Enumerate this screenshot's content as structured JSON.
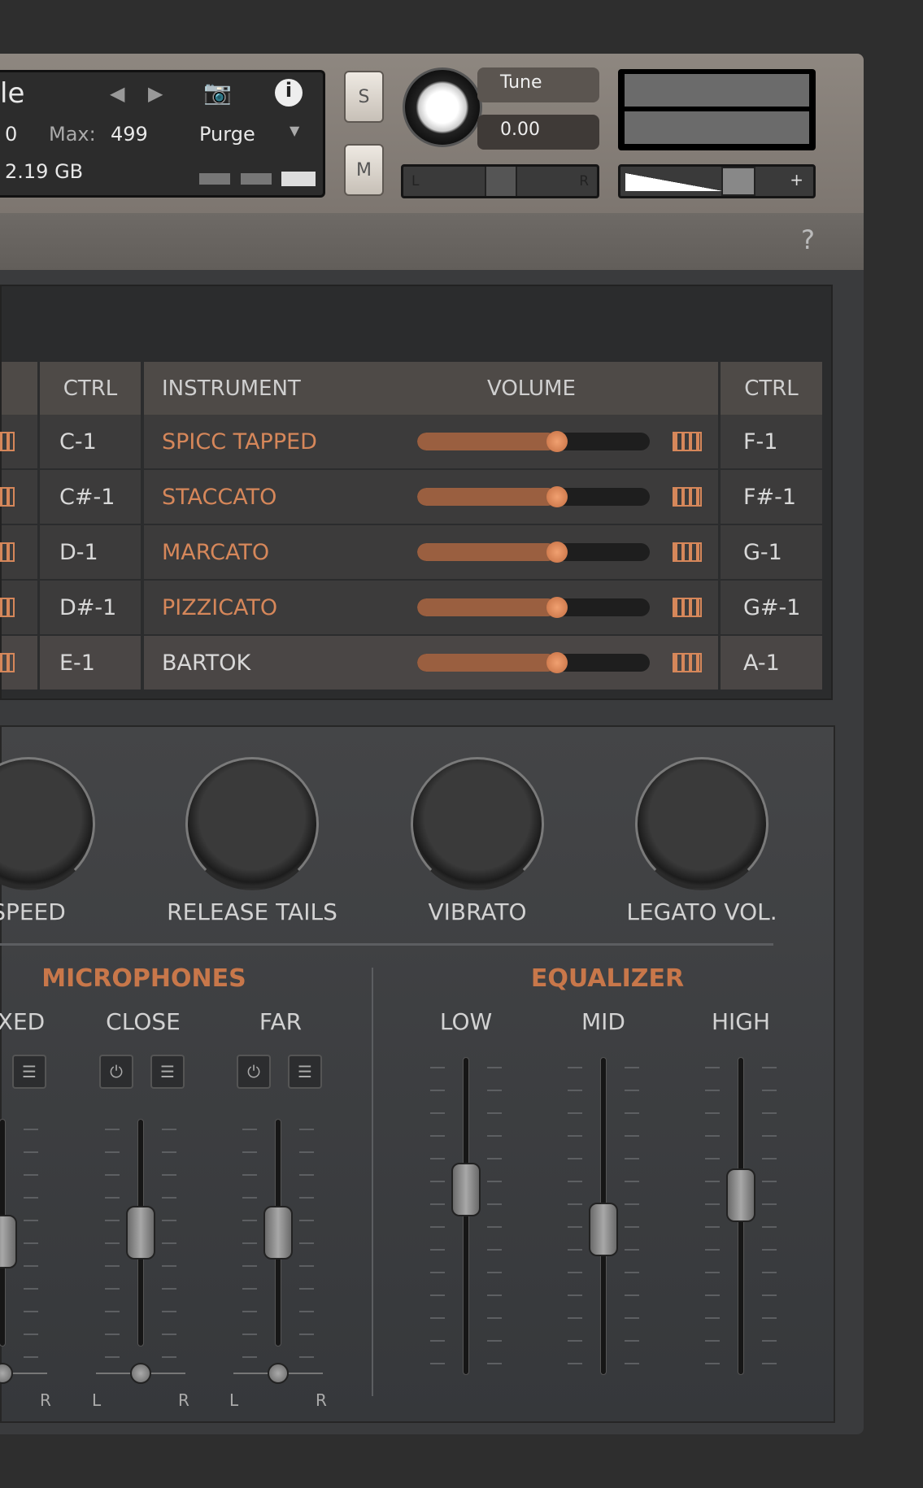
{
  "header": {
    "instrument_name_partial": "le",
    "voices": "0",
    "max_label": "Max:",
    "max_value": "499",
    "memory": "2.19 GB",
    "purge_label": "Purge",
    "solo": "S",
    "mute": "M",
    "tune_label": "Tune",
    "tune_value": "0.00",
    "pan_left": "L",
    "pan_right": "R",
    "vol_minus": "-",
    "vol_plus": "+",
    "help": "?"
  },
  "table": {
    "headers": [
      "CTRL",
      "INSTRUMENT",
      "VOLUME",
      "CTRL"
    ],
    "rows": [
      {
        "ctrl_left": "C-1",
        "instrument": "SPICC TAPPED",
        "volume": 0.6,
        "ctrl_right": "F-1",
        "active": false
      },
      {
        "ctrl_left": "C#-1",
        "instrument": "STACCATO",
        "volume": 0.6,
        "ctrl_right": "F#-1",
        "active": false
      },
      {
        "ctrl_left": "D-1",
        "instrument": "MARCATO",
        "volume": 0.6,
        "ctrl_right": "G-1",
        "active": false
      },
      {
        "ctrl_left": "D#-1",
        "instrument": "PIZZICATO",
        "volume": 0.6,
        "ctrl_right": "G#-1",
        "active": false
      },
      {
        "ctrl_left": "E-1",
        "instrument": "BARTOK",
        "volume": 0.6,
        "ctrl_right": "A-1",
        "active": true
      }
    ]
  },
  "knobs": [
    "SPEED",
    "RELEASE TAILS",
    "VIBRATO",
    "LEGATO VOL."
  ],
  "microphones": {
    "title": "MICROPHONES",
    "channels": [
      {
        "name": "XED",
        "level": 0.45
      },
      {
        "name": "CLOSE",
        "level": 0.5
      },
      {
        "name": "FAR",
        "level": 0.5
      }
    ],
    "left": "L",
    "right": "R"
  },
  "equalizer": {
    "title": "EQUALIZER",
    "bands": [
      {
        "name": "LOW",
        "level": 0.6
      },
      {
        "name": "MID",
        "level": 0.45
      },
      {
        "name": "HIGH",
        "level": 0.58
      }
    ]
  },
  "colors": {
    "accent": "#d6875a",
    "header": "#8a827b"
  }
}
